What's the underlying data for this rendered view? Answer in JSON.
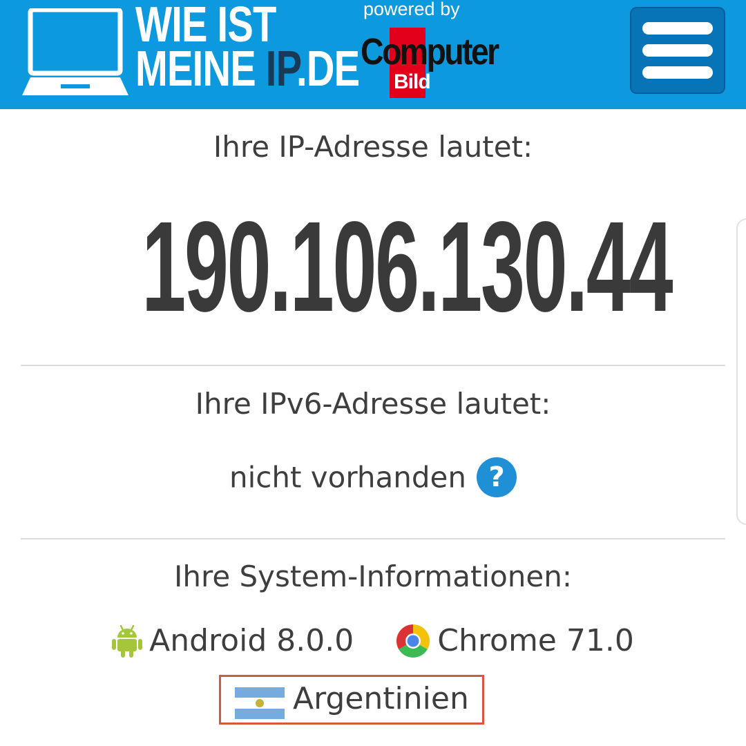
{
  "header": {
    "brand_line1": "WIE IST",
    "brand_line2_a": "MEINE ",
    "brand_line2_b": "IP",
    "brand_line2_c": ".DE",
    "powered_by": "powered by",
    "partner_logo_word": "Computer",
    "partner_logo_sub": "Bild",
    "menu_icon": "hamburger-menu-icon",
    "brand_color": "#0d99dd"
  },
  "ipv4": {
    "label": "Ihre IP-Adresse lautet:",
    "value": "190.106.130.44"
  },
  "ipv6": {
    "label": "Ihre IPv6-Adresse lautet:",
    "value": "nicht vorhanden",
    "help_glyph": "?"
  },
  "system": {
    "label": "Ihre System-Informationen:",
    "os": "Android 8.0.0",
    "os_icon": "android-icon",
    "browser": "Chrome 71.0",
    "browser_icon": "chrome-icon",
    "country": "Argentinien",
    "country_icon": "argentina-flag-icon",
    "highlight_color": "#d35a3a"
  }
}
